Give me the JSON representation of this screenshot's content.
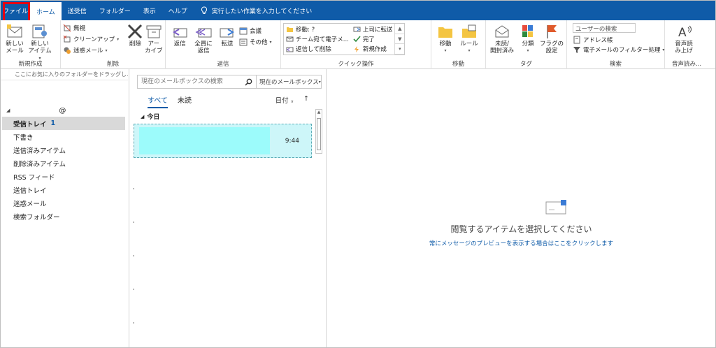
{
  "tabs": {
    "file": "ファイル",
    "home": "ホーム",
    "send_receive": "送受信",
    "folder": "フォルダー",
    "view": "表示",
    "help": "ヘルプ",
    "tell_me": "実行したい作業を入力してください"
  },
  "ribbon": {
    "new": {
      "new_mail": "新しい\nメール",
      "new_item": "新しい\nアイテム",
      "label": "新規作成"
    },
    "delete": {
      "ignore": "無視",
      "cleanup": "クリーンアップ",
      "junk": "迷惑メール",
      "delete": "削除",
      "archive": "アー\nカイブ",
      "label": "削除"
    },
    "respond": {
      "reply": "返信",
      "reply_all": "全員に\n返信",
      "forward": "転送",
      "meeting": "会議",
      "more": "その他",
      "label": "返信"
    },
    "quick_steps": {
      "move_to": "移動: ?",
      "team_email": "チーム宛て電子メ...",
      "reply_delete": "返信して削除",
      "to_manager": "上司に転送",
      "done": "完了",
      "create_new": "新規作成",
      "label": "クイック操作"
    },
    "move": {
      "move": "移動",
      "rules": "ルール",
      "label": "移動"
    },
    "tags": {
      "unread_read": "未読/\n開封済み",
      "categorize": "分類",
      "followup": "フラグの\n設定",
      "label": "タグ"
    },
    "find": {
      "search_people": "ユーザーの検索",
      "address_book": "アドレス帳",
      "filter_email": "電子メールのフィルター処理",
      "label": "検索"
    },
    "speech": {
      "read_aloud": "音声読\nみ上げ",
      "label": "音声読み..."
    }
  },
  "folder_pane": {
    "favorites_hint": "ここにお気に入りのフォルダーをドラッグし...",
    "account": "@",
    "folders": [
      {
        "name": "受信トレイ",
        "count": "1"
      },
      {
        "name": "下書き",
        "count": ""
      },
      {
        "name": "送信済みアイテム",
        "count": ""
      },
      {
        "name": "削除済みアイテム",
        "count": ""
      },
      {
        "name": "RSS フィード",
        "count": ""
      },
      {
        "name": "送信トレイ",
        "count": ""
      },
      {
        "name": "迷惑メール",
        "count": ""
      },
      {
        "name": "検索フォルダー",
        "count": ""
      }
    ]
  },
  "message_list": {
    "search_placeholder": "現在のメールボックスの検索",
    "scope": "現在のメールボックス",
    "filter_all": "すべて",
    "filter_unread": "未読",
    "sort_by": "日付",
    "group_today": "今日",
    "messages": [
      {
        "time": "9:44"
      }
    ]
  },
  "reading_pane": {
    "empty_message": "閲覧するアイテムを選択してください",
    "preview_link": "常にメッセージのプレビューを表示する場合はここをクリックします"
  },
  "colors": {
    "accent": "#0f5ba8",
    "highlight_outline": "#e60012",
    "selected_item": "#cdf6f9"
  }
}
